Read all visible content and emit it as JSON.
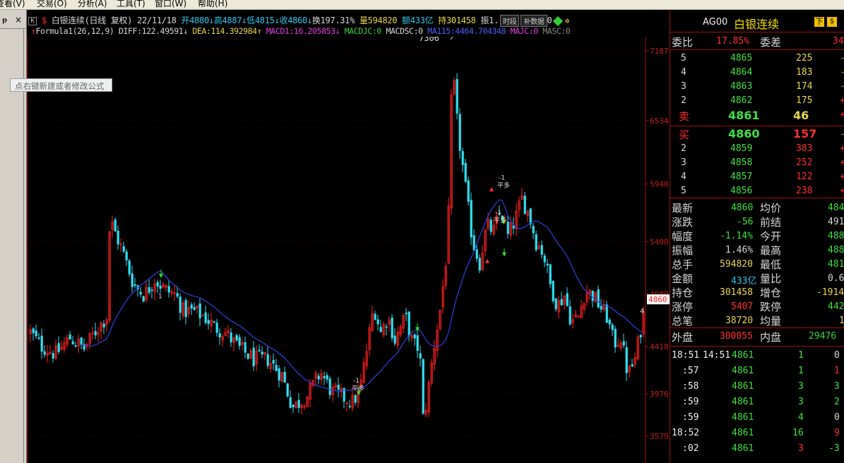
{
  "menu": [
    "查看(V)",
    "交易(O)",
    "分析(A)",
    "工具(T)",
    "窗口(W)",
    "帮助(H)"
  ],
  "tooltip": "点右键新建或者修改公式",
  "info": {
    "k_label": "K",
    "dollar": "$",
    "title": "白银连续(日线 复权)",
    "date": "22/11/18",
    "open": "开4880",
    "high": "高4887",
    "low": "低4815",
    "close": "收4860",
    "turnover": "换197.31%",
    "volume": "量594820",
    "amount": "额433亿",
    "position": "持301458",
    "amp": "振1.",
    "btn_period": "时段",
    "btn_fill": "补数据",
    "trail": "0"
  },
  "formula": {
    "name": "Formula1(26,12,9)",
    "diff": "DIFF:122.49591",
    "dea": "DEA:114.392984",
    "macd1": "MACD1:16.205853",
    "macdjc": "MACDJC:0",
    "macdsc": "MACDSC:0",
    "ma115": "MA115:4464.704348",
    "majc": "MAJC:0",
    "masc": "MASC:0"
  },
  "yaxis": [
    "7187",
    "6534",
    "5940",
    "5400",
    "4909",
    "4418",
    "3976",
    "3579"
  ],
  "annotations": {
    "peak": "7306",
    "current_tag": "4860",
    "signal_label_minus": "-1",
    "signal_label_text": "平多",
    "signal_label_one": "1",
    "signal_four": "4"
  },
  "colors": {
    "up": "#ff2020",
    "down": "#30e0f0",
    "ma": "#3040e0",
    "grid": "#5a0000",
    "axis": "#a01010"
  },
  "right": {
    "code": "AG00",
    "name": "白银连续",
    "btnF": "下",
    "btnD": "$",
    "weibi_label": "委比",
    "weibi": "17.85%",
    "weicha_label": "委差",
    "weicha": "34",
    "asks": [
      {
        "level": "5",
        "price": "4865",
        "vol": "225",
        "chg": "-"
      },
      {
        "level": "4",
        "price": "4864",
        "vol": "183",
        "chg": "-"
      },
      {
        "level": "3",
        "price": "4863",
        "vol": "174",
        "chg": "-"
      },
      {
        "level": "2",
        "price": "4862",
        "vol": "175",
        "chg": "+"
      },
      {
        "level": "卖",
        "price": "4861",
        "vol": "46",
        "chg": "+"
      }
    ],
    "bids": [
      {
        "level": "买",
        "price": "4860",
        "vol": "157",
        "chg": "-"
      },
      {
        "level": "2",
        "price": "4859",
        "vol": "383",
        "chg": "+"
      },
      {
        "level": "3",
        "price": "4858",
        "vol": "252",
        "chg": "+"
      },
      {
        "level": "4",
        "price": "4857",
        "vol": "122",
        "chg": "+"
      },
      {
        "level": "5",
        "price": "4856",
        "vol": "238",
        "chg": "+"
      }
    ],
    "stats": [
      {
        "l1": "最新",
        "v1": "4860",
        "c1": "#40e040",
        "l2": "均价",
        "v2": "484",
        "c2": "#40e040"
      },
      {
        "l1": "涨跌",
        "v1": "-56",
        "c1": "#40e040",
        "l2": "前结",
        "v2": "491",
        "c2": "#d8d8d8"
      },
      {
        "l1": "幅度",
        "v1": "-1.14%",
        "c1": "#40e040",
        "l2": "今开",
        "v2": "488",
        "c2": "#40e040"
      },
      {
        "l1": "振幅",
        "v1": "1.46%",
        "c1": "#d8d8d8",
        "l2": "最高",
        "v2": "488",
        "c2": "#40e040"
      },
      {
        "l1": "总手",
        "v1": "594820",
        "c1": "#e6d84a",
        "l2": "最低",
        "v2": "481",
        "c2": "#40e040"
      },
      {
        "l1": "金额",
        "v1": "433亿",
        "c1": "#33c6e8",
        "l2": "量比",
        "v2": "0.6",
        "c2": "#d8d8d8"
      },
      {
        "l1": "持仓",
        "v1": "301458",
        "c1": "#e6d84a",
        "l2": "增仓",
        "v2": "-1914",
        "c2": "#e6d84a"
      },
      {
        "l1": "涨停",
        "v1": "5407",
        "c1": "#ff3030",
        "l2": "跌停",
        "v2": "442",
        "c2": "#40e040"
      },
      {
        "l1": "总笔",
        "v1": "38720",
        "c1": "#e6d84a",
        "l2": "均量",
        "v2": "1",
        "c2": "#e6d84a"
      }
    ],
    "outer_label": "外盘",
    "outer": "300055",
    "inner_label": "内盘",
    "inner": "29476",
    "ticks": [
      {
        "time": "18:51",
        "time2": "14:51",
        "price": "4861",
        "vol": "1",
        "pos": "0",
        "vc": "#40e040",
        "pc": "#d8d8d8"
      },
      {
        "time": ":57",
        "time2": "",
        "price": "4861",
        "vol": "1",
        "pos": "1",
        "vc": "#40e040",
        "pc": "#ff3030"
      },
      {
        "time": ":58",
        "time2": "",
        "price": "4861",
        "vol": "3",
        "pos": "3",
        "vc": "#40e040",
        "pc": "#40e040"
      },
      {
        "time": ":59",
        "time2": "",
        "price": "4861",
        "vol": "3",
        "pos": "2",
        "vc": "#40e040",
        "pc": "#40e040"
      },
      {
        "time": ":59",
        "time2": "",
        "price": "4861",
        "vol": "4",
        "pos": "0",
        "vc": "#40e040",
        "pc": "#d8d8d8"
      },
      {
        "time": "18:52",
        "time2": "",
        "price": "4861",
        "vol": "16",
        "pos": "9",
        "vc": "#40e040",
        "pc": "#ff3030"
      },
      {
        "time": ":02",
        "time2": "",
        "price": "4861",
        "vol": "3",
        "pos": "-3",
        "vc": "#ff3030",
        "pc": "#40e040"
      }
    ]
  }
}
